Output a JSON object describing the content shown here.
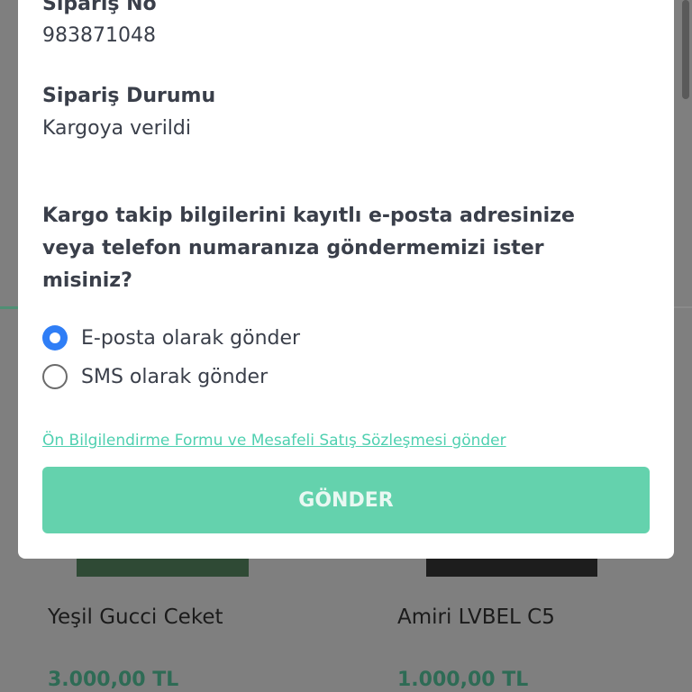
{
  "modal": {
    "order_no_label": "Sipariş No",
    "order_no_value": "983871048",
    "order_status_label": "Sipariş Durumu",
    "order_status_value": "Kargoya verildi",
    "question": "Kargo takip bilgilerini kayıtlı e-posta adresinize veya telefon numaranıza göndermemizi ister misiniz?",
    "options": [
      {
        "label": "E-posta olarak gönder",
        "selected": true
      },
      {
        "label": "SMS olarak gönder",
        "selected": false
      }
    ],
    "link_text": "Ön Bilgilendirme Formu ve Mesafeli Satış Sözleşmesi gönder",
    "submit_label": "GÖNDER"
  },
  "background": {
    "products": [
      {
        "name": "Yeşil Gucci Ceket",
        "price": "3.000,00 TL"
      },
      {
        "name": "Amiri LVBEL C5",
        "price": "1.000,00 TL"
      }
    ]
  },
  "colors": {
    "accent_button": "#64d2ad",
    "link": "#4fd0b0",
    "radio_selected": "#2f7ef6",
    "price": "#2e6b55"
  }
}
